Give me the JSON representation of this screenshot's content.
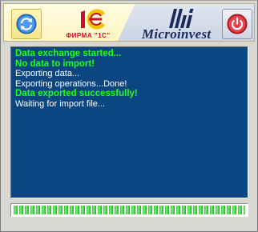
{
  "header": {
    "sync_button_icon": "sync-icon",
    "logo_1c_mark": "1С",
    "logo_1c_caption": "ФИРМА \"1С\"",
    "brand_logo_mark": "Mi",
    "brand_name": "Microinvest",
    "power_button_icon": "power-icon"
  },
  "log": {
    "lines": [
      {
        "text": "Data exchange started...",
        "style": "bold"
      },
      {
        "text": "No data to import!",
        "style": "bold"
      },
      {
        "text": "Exporting data...",
        "style": "normal"
      },
      {
        "text": "Exporting operations...Done!",
        "style": "normal"
      },
      {
        "text": "Data exported successfully!",
        "style": "bold"
      },
      {
        "text": "Waiting for import file...",
        "style": "normal"
      }
    ]
  },
  "progress": {
    "value_percent": 100
  },
  "colors": {
    "log_background": "#0b4680",
    "log_text_highlight": "#1eff1e",
    "log_text_normal": "#ffffff",
    "progress_fill": "#33c633",
    "brand_red": "#c8102e",
    "brand_navy": "#1a2a5c"
  }
}
